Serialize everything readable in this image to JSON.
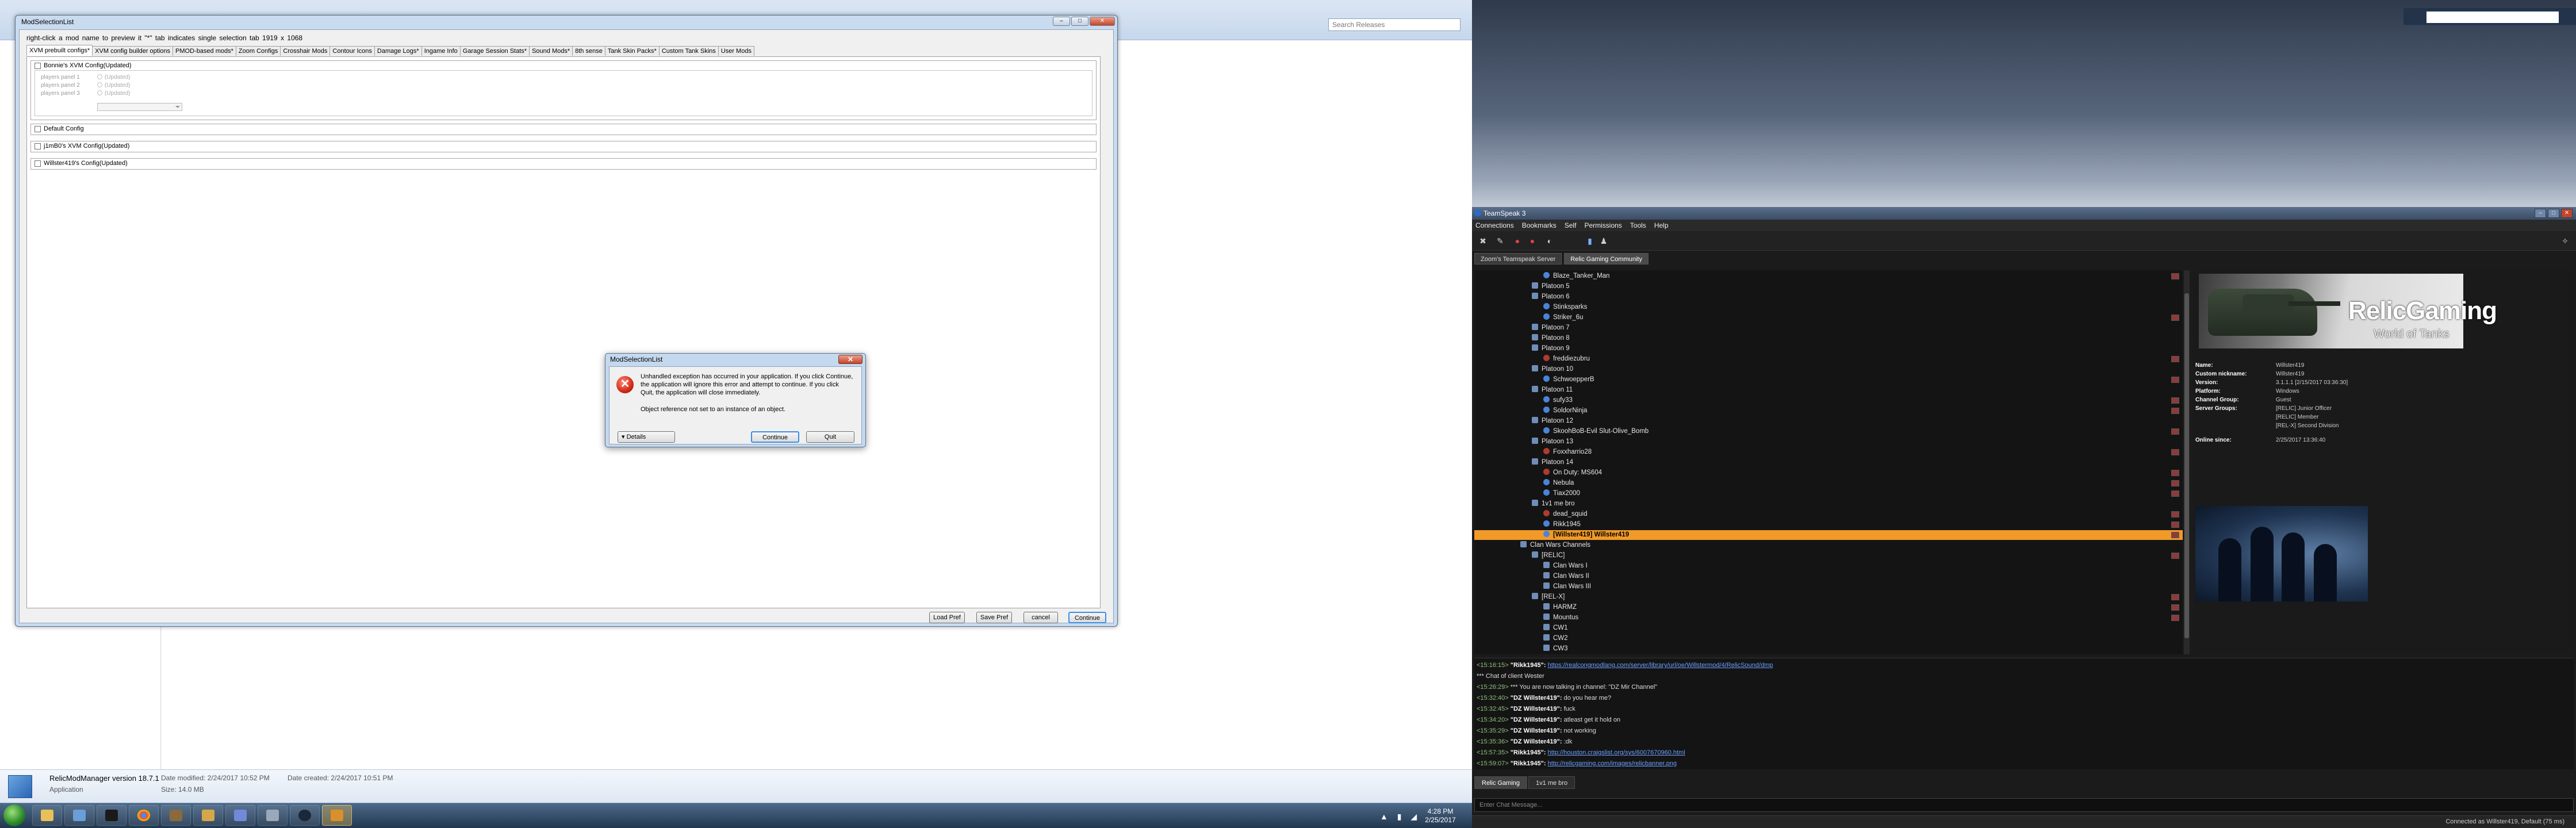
{
  "explorer": {
    "search_placeholder": "Search Releases",
    "selected_file": {
      "name": "RelicModManager version 18.7.1",
      "type": "Application",
      "date_modified_label": "Date modified:",
      "date_modified": "2/24/2017 10:52 PM",
      "date_created_label": "Date created:",
      "date_created": "2/24/2017 10:51 PM",
      "size_label": "Size:",
      "size": "14.0 MB"
    }
  },
  "taskbar": {
    "time": "4:28 PM",
    "date": "2/25/2017",
    "items": [
      "explorer",
      "mail",
      "terminal",
      "chrome",
      "tanks",
      "folder",
      "discord",
      "misc",
      "steam",
      "modmanager"
    ]
  },
  "mod_window": {
    "title": "ModSelectionList",
    "hint": "right-click a mod name to preview it     \"*\" tab indicates single selection tab     1919 x 1068",
    "tabs": [
      "XVM prebuilt configs*",
      "XVM config builder options",
      "PMOD-based mods*",
      "Zoom Configs",
      "Crosshair Mods",
      "Contour Icons",
      "Damage Logs*",
      "Ingame Info",
      "Garage Session Stats*",
      "Sound Mods*",
      "8th sense",
      "Tank Skin Packs*",
      "Custom Tank Skins",
      "User Mods"
    ],
    "configs": [
      {
        "label": "Bonnie's XVM Config(Updated)"
      },
      {
        "label": "Default Config"
      },
      {
        "label": "j1mB0's XVM Config(Updated)"
      },
      {
        "label": "Willster419's Config(Updated)"
      }
    ],
    "player_panels": {
      "labels": [
        "players panel 1",
        "players panel 2",
        "players panel 3"
      ],
      "radio_text": "(Updated)"
    },
    "buttons": {
      "load_pref": "Load Pref",
      "save_pref": "Save Pref",
      "cancel": "cancel",
      "continue": "Continue"
    }
  },
  "error_dialog": {
    "title": "ModSelectionList",
    "message": "Unhandled exception has occurred in your application. If you click Continue, the application will ignore this error and attempt to continue. If you click Quit, the application will close immediately.",
    "detail": "Object reference not set to an instance of an object.",
    "details_button": "Details",
    "continue_button": "Continue",
    "quit_button": "Quit"
  },
  "teamspeak": {
    "title": "TeamSpeak 3",
    "menu": [
      "Connections",
      "Bookmarks",
      "Self",
      "Permissions",
      "Tools",
      "Help"
    ],
    "server_tabs": [
      "Zoom's Teamspeak Server",
      "Relic Gaming Community"
    ],
    "tree": [
      {
        "indent": 3,
        "kind": "client",
        "name": "Blaze_Tanker_Man",
        "flag": true
      },
      {
        "indent": 2,
        "kind": "channel",
        "name": "Platoon 5"
      },
      {
        "indent": 2,
        "kind": "channel",
        "name": "Platoon 6"
      },
      {
        "indent": 3,
        "kind": "client",
        "name": "Stinksparks"
      },
      {
        "indent": 3,
        "kind": "client",
        "name": "Striker_6u",
        "flag": true
      },
      {
        "indent": 2,
        "kind": "channel",
        "name": "Platoon 7"
      },
      {
        "indent": 2,
        "kind": "channel",
        "name": "Platoon 8"
      },
      {
        "indent": 2,
        "kind": "channel",
        "name": "Platoon 9"
      },
      {
        "indent": 3,
        "kind": "mute",
        "name": "freddiezubru",
        "flag": true
      },
      {
        "indent": 2,
        "kind": "channel",
        "name": "Platoon 10"
      },
      {
        "indent": 3,
        "kind": "client",
        "name": "SchwoepperB",
        "flag": true
      },
      {
        "indent": 2,
        "kind": "channel",
        "name": "Platoon 11"
      },
      {
        "indent": 3,
        "kind": "client",
        "name": "sufy33",
        "flag": true
      },
      {
        "indent": 3,
        "kind": "client",
        "name": "SoldorNinja",
        "flag": true
      },
      {
        "indent": 2,
        "kind": "channel",
        "name": "Platoon 12"
      },
      {
        "indent": 3,
        "kind": "client",
        "name": "SkoohBoB-Evil Slut-Olive_Bomb",
        "flag": true
      },
      {
        "indent": 2,
        "kind": "channel",
        "name": "Platoon 13"
      },
      {
        "indent": 3,
        "kind": "mute",
        "name": "Foxxharrio28",
        "flag": true
      },
      {
        "indent": 2,
        "kind": "channel",
        "name": "Platoon 14"
      },
      {
        "indent": 3,
        "kind": "mute",
        "name": "On Duty: MS604",
        "flag": true
      },
      {
        "indent": 3,
        "kind": "client",
        "name": "Nebula",
        "flag": true
      },
      {
        "indent": 3,
        "kind": "client",
        "name": "Tiax2000",
        "flag": true
      },
      {
        "indent": 2,
        "kind": "channel",
        "name": "1v1 me bro"
      },
      {
        "indent": 3,
        "kind": "mute",
        "name": "dead_squid",
        "flag": true
      },
      {
        "indent": 3,
        "kind": "client",
        "name": "Rikk1945",
        "flag": true
      },
      {
        "indent": 3,
        "kind": "client",
        "name": "[Willster419] Willster419",
        "flag": true,
        "selected": true
      },
      {
        "indent": 1,
        "kind": "channel",
        "name": "Clan Wars Channels"
      },
      {
        "indent": 2,
        "kind": "channel",
        "name": "[RELIC]",
        "flag": true
      },
      {
        "indent": 3,
        "kind": "channel",
        "name": "Clan Wars I"
      },
      {
        "indent": 3,
        "kind": "channel",
        "name": "Clan Wars II"
      },
      {
        "indent": 3,
        "kind": "channel",
        "name": "Clan Wars III"
      },
      {
        "indent": 2,
        "kind": "channel",
        "name": "[REL-X]",
        "flag": true
      },
      {
        "indent": 3,
        "kind": "channel",
        "name": "HARMZ",
        "flag": true
      },
      {
        "indent": 3,
        "kind": "channel",
        "name": "Mountus",
        "flag": true
      },
      {
        "indent": 3,
        "kind": "channel",
        "name": "CW1"
      },
      {
        "indent": 3,
        "kind": "channel",
        "name": "CW2"
      },
      {
        "indent": 3,
        "kind": "channel",
        "name": "CW3"
      }
    ],
    "banner": {
      "title": "RelicGaming",
      "subtitle": "World of Tanks"
    },
    "info": [
      {
        "key": "Name:",
        "value": "Willster419"
      },
      {
        "key": "Custom nickname:",
        "value": "Willster419"
      },
      {
        "key": "Version:",
        "value": "3.1.1.1 [2/15/2017 03:36:30]"
      },
      {
        "key": "Platform:",
        "value": "Windows"
      },
      {
        "key": "Channel Group:",
        "value": "Guest"
      },
      {
        "key": "Server Groups:",
        "value": "[RELIC] Junior Officer"
      },
      {
        "key": "",
        "value": "[RELIC] Member"
      },
      {
        "key": "",
        "value": "[REL-X] Second Division"
      },
      {
        "key": "Online since:",
        "value": "2/25/2017 13:36:40"
      }
    ],
    "chat": [
      {
        "time": "<15:16:15>",
        "nick": "\"Rikk1945\":",
        "text": "",
        "link": "https://realcongmodlang.com/server/library/url/oe/Willstermod/4/RelicSound/dmp"
      },
      {
        "time": "",
        "nick": "",
        "text": "*** Chat of client Wester",
        "link": ""
      },
      {
        "time": "<15:26:29>",
        "nick": "",
        "text": "*** You are now talking in channel: \"DZ Mir Channel\"",
        "link": ""
      },
      {
        "time": "<15:32:40>",
        "nick": "\"DZ Willster419\":",
        "text": "do you hear me?",
        "link": ""
      },
      {
        "time": "<15:32:45>",
        "nick": "\"DZ Willster419\":",
        "text": "fuck",
        "link": ""
      },
      {
        "time": "<15:34:20>",
        "nick": "\"DZ Willster419\":",
        "text": "atleast get it hold on",
        "link": ""
      },
      {
        "time": "<15:35:29>",
        "nick": "\"DZ Willster419\":",
        "text": "not working",
        "link": ""
      },
      {
        "time": "<15:35:36>",
        "nick": "\"DZ Willster419\":",
        "text": ":dk",
        "link": ""
      },
      {
        "time": "<15:57:35>",
        "nick": "\"Rikk1945\":",
        "text": "",
        "link": "http://houston.craigslist.org/sys/6007670960.html"
      },
      {
        "time": "<15:59:07>",
        "nick": "\"Rikk1945\":",
        "text": "",
        "link": "http://relicgaming.com/images/relicbanner.png"
      }
    ],
    "chat_tabs": [
      "Relic Gaming",
      "1v1 me bro"
    ],
    "input_placeholder": "Enter Chat Message...",
    "status": "Connected as Willster419, Default (75 ms)"
  }
}
